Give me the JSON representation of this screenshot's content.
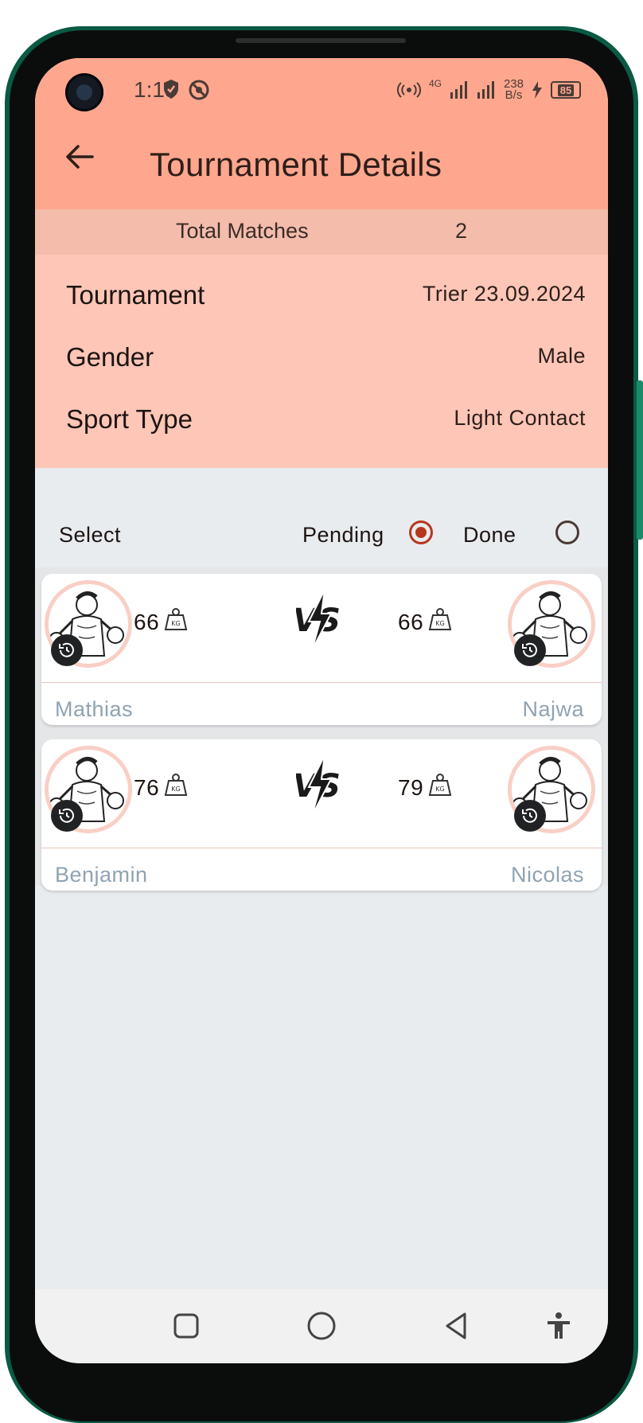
{
  "status_bar": {
    "time": "1:18",
    "network_speed_value": "238",
    "network_speed_unit": "B/s",
    "network_type": "4G",
    "battery": "85"
  },
  "app_bar": {
    "title": "Tournament Details"
  },
  "summary": {
    "total_matches_label": "Total Matches",
    "total_matches_value": "2"
  },
  "details": [
    {
      "label": "Tournament",
      "value": "Trier 23.09.2024"
    },
    {
      "label": "Gender",
      "value": "Male"
    },
    {
      "label": "Sport Type",
      "value": "Light Contact"
    }
  ],
  "filter": {
    "label": "Select",
    "options": [
      {
        "label": "Pending",
        "selected": true
      },
      {
        "label": "Done",
        "selected": false
      }
    ]
  },
  "matches": [
    {
      "left": {
        "name": "Mathias",
        "weight": "66",
        "unit": "KG"
      },
      "right": {
        "name": "Najwa",
        "weight": "66",
        "unit": "KG"
      }
    },
    {
      "left": {
        "name": "Benjamin",
        "weight": "76",
        "unit": "KG"
      },
      "right": {
        "name": "Nicolas",
        "weight": "79",
        "unit": "KG"
      }
    }
  ],
  "vs_label": "VS",
  "colors": {
    "app_bar": "#ffa78e",
    "summary_bar": "#f4bcab",
    "details_bg": "#fdc6b7",
    "radio_selected": "#b7361f",
    "player_name": "#8fa3b3"
  }
}
